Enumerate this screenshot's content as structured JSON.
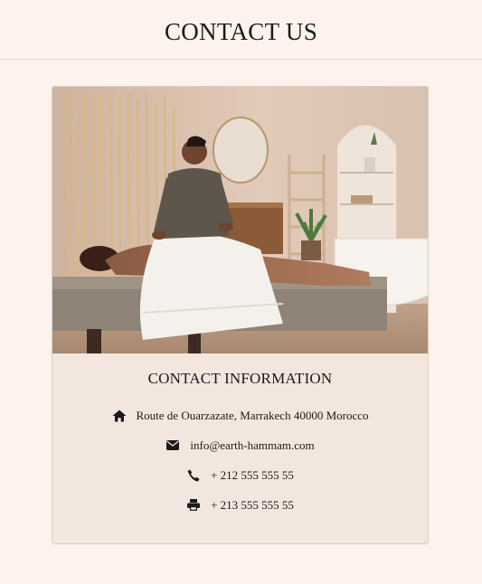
{
  "page": {
    "title": "CONTACT US"
  },
  "card": {
    "image_alt": "Massage therapist treating a client on a spa table",
    "title": "CONTACT INFORMATION",
    "items": [
      {
        "icon": "home-icon",
        "text": "Route de Ouarzazate, Marrakech 40000 Morocco"
      },
      {
        "icon": "envelope-icon",
        "text": "info@earth-hammam.com"
      },
      {
        "icon": "phone-icon",
        "text": "+ 212 555 555 55"
      },
      {
        "icon": "printer-icon",
        "text": "+ 213 555 555 55"
      }
    ]
  },
  "colors": {
    "page_background": "#fdf3ec",
    "card_background": "#f3e6df",
    "text": "#1a1a1a"
  }
}
